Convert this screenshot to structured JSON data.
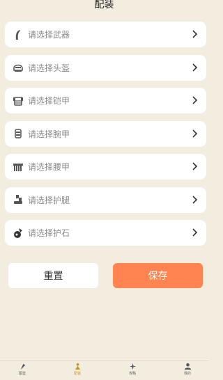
{
  "header": {
    "title": "配装"
  },
  "slots": [
    {
      "label": "请选择武器",
      "icon": "weapon-icon"
    },
    {
      "label": "请选择头盔",
      "icon": "helmet-icon"
    },
    {
      "label": "请选择铠甲",
      "icon": "armor-icon"
    },
    {
      "label": "请选择腕甲",
      "icon": "bracer-icon"
    },
    {
      "label": "请选择腰甲",
      "icon": "belt-icon"
    },
    {
      "label": "请选择护腿",
      "icon": "greaves-icon"
    },
    {
      "label": "请选择护石",
      "icon": "charm-icon"
    }
  ],
  "actions": {
    "reset_label": "重置",
    "save_label": "保存"
  },
  "tabbar": {
    "items": [
      {
        "label": "图鉴",
        "icon": "codex-icon"
      },
      {
        "label": "配装",
        "icon": "loadout-icon"
      },
      {
        "label": "攻略",
        "icon": "guide-icon"
      },
      {
        "label": "我的",
        "icon": "profile-icon"
      }
    ],
    "active_index": 1
  },
  "colors": {
    "accent": "#ff8451",
    "background": "#f3ede0",
    "active_tab": "#c9962f"
  }
}
